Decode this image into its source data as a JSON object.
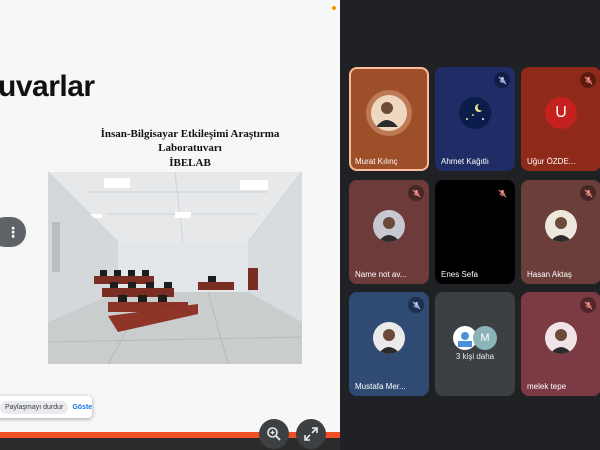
{
  "slide": {
    "title": "uvarlar",
    "subtitle_line1": "İnsan-Bilgisayar Etkileşimi Araştırma",
    "subtitle_line2": "Laboratuvarı",
    "subtitle_line3": "İBELAB"
  },
  "share_popup": {
    "stop_label": "Paylaşmayı durdur",
    "show_label": "Göste"
  },
  "menu_glyph": "⋮",
  "participants": [
    {
      "name": "Murat Kılınç",
      "bg": "#9c4f28",
      "muted": false,
      "active": true
    },
    {
      "name": "Ahmet Kağıtlı",
      "bg": "#1f2c66",
      "muted": true
    },
    {
      "name": "Uğur ÖZDE...",
      "bg": "#8f2a1a",
      "muted": true,
      "initial": "U"
    },
    {
      "name": "Name not av...",
      "bg": "#6e3b3b",
      "muted": true
    },
    {
      "name": "Enes Sefa",
      "bg": "#000000",
      "muted": true
    },
    {
      "name": "Hasan Aktaş",
      "bg": "#6b3e3a",
      "muted": true
    },
    {
      "name": "Mustafa Mer...",
      "bg": "#2f4a73",
      "muted": true
    },
    {
      "name": "3 kişi daha",
      "bg": "#3c4043",
      "initial": "M"
    },
    {
      "name": "melek tepe",
      "bg": "#7b3a44",
      "muted": true
    }
  ]
}
